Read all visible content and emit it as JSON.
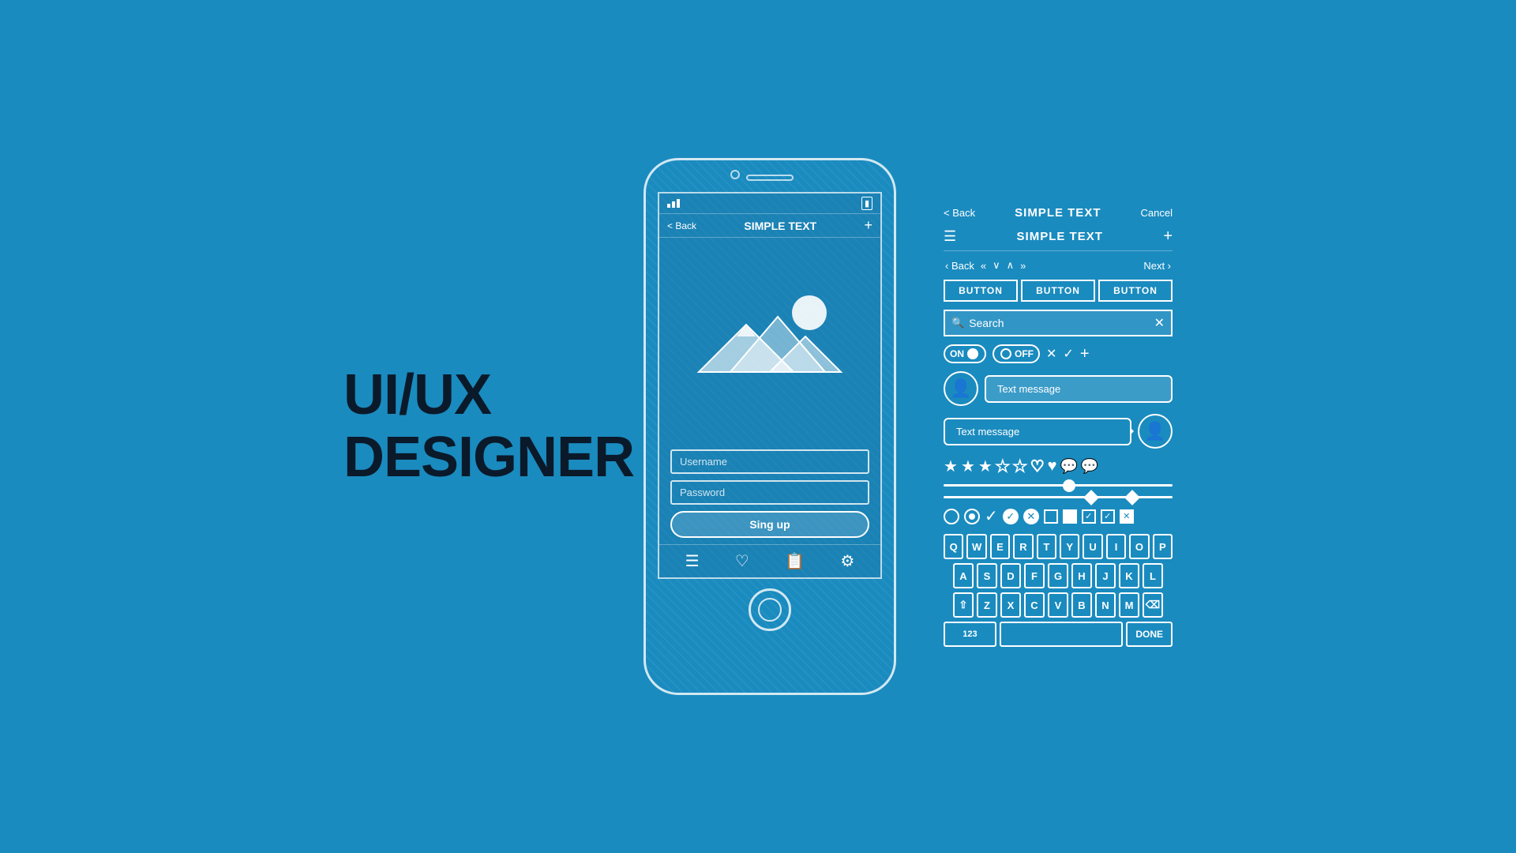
{
  "title": {
    "line1": "UI/UX",
    "line2": "DESIGNER"
  },
  "phone": {
    "nav_back": "< Back",
    "nav_title": "SIMPLE TEXT",
    "nav_plus": "+",
    "username_placeholder": "Username",
    "password_placeholder": "Password",
    "signup_button": "Sing up",
    "bottom_icons": [
      "☰",
      "♡",
      "📋",
      "⚙"
    ]
  },
  "panel": {
    "top_back": "< Back",
    "top_title": "SIMPLE TEXT",
    "top_cancel": "Cancel",
    "toolbar_title": "SIMPLE TEXT",
    "nav_items": [
      "< Back",
      "«",
      "∨",
      "∧",
      "»",
      "Next >"
    ],
    "buttons": [
      "BUTTON",
      "BUTTON",
      "BUTTON"
    ],
    "search_placeholder": "Search",
    "toggle_on_label": "ON",
    "toggle_off_label": "OFF",
    "msg_placeholder_right": "Text message",
    "msg_placeholder_left": "Text message",
    "keyboard": {
      "row1": [
        "Q",
        "W",
        "E",
        "R",
        "T",
        "Y",
        "U",
        "I",
        "O",
        "P"
      ],
      "row2": [
        "A",
        "S",
        "D",
        "F",
        "G",
        "H",
        "J",
        "K",
        "L"
      ],
      "row3": [
        "⇧",
        "Z",
        "X",
        "C",
        "V",
        "B",
        "N",
        "M",
        "⌫"
      ],
      "row4_left": "123",
      "row4_done": "DONE"
    }
  }
}
